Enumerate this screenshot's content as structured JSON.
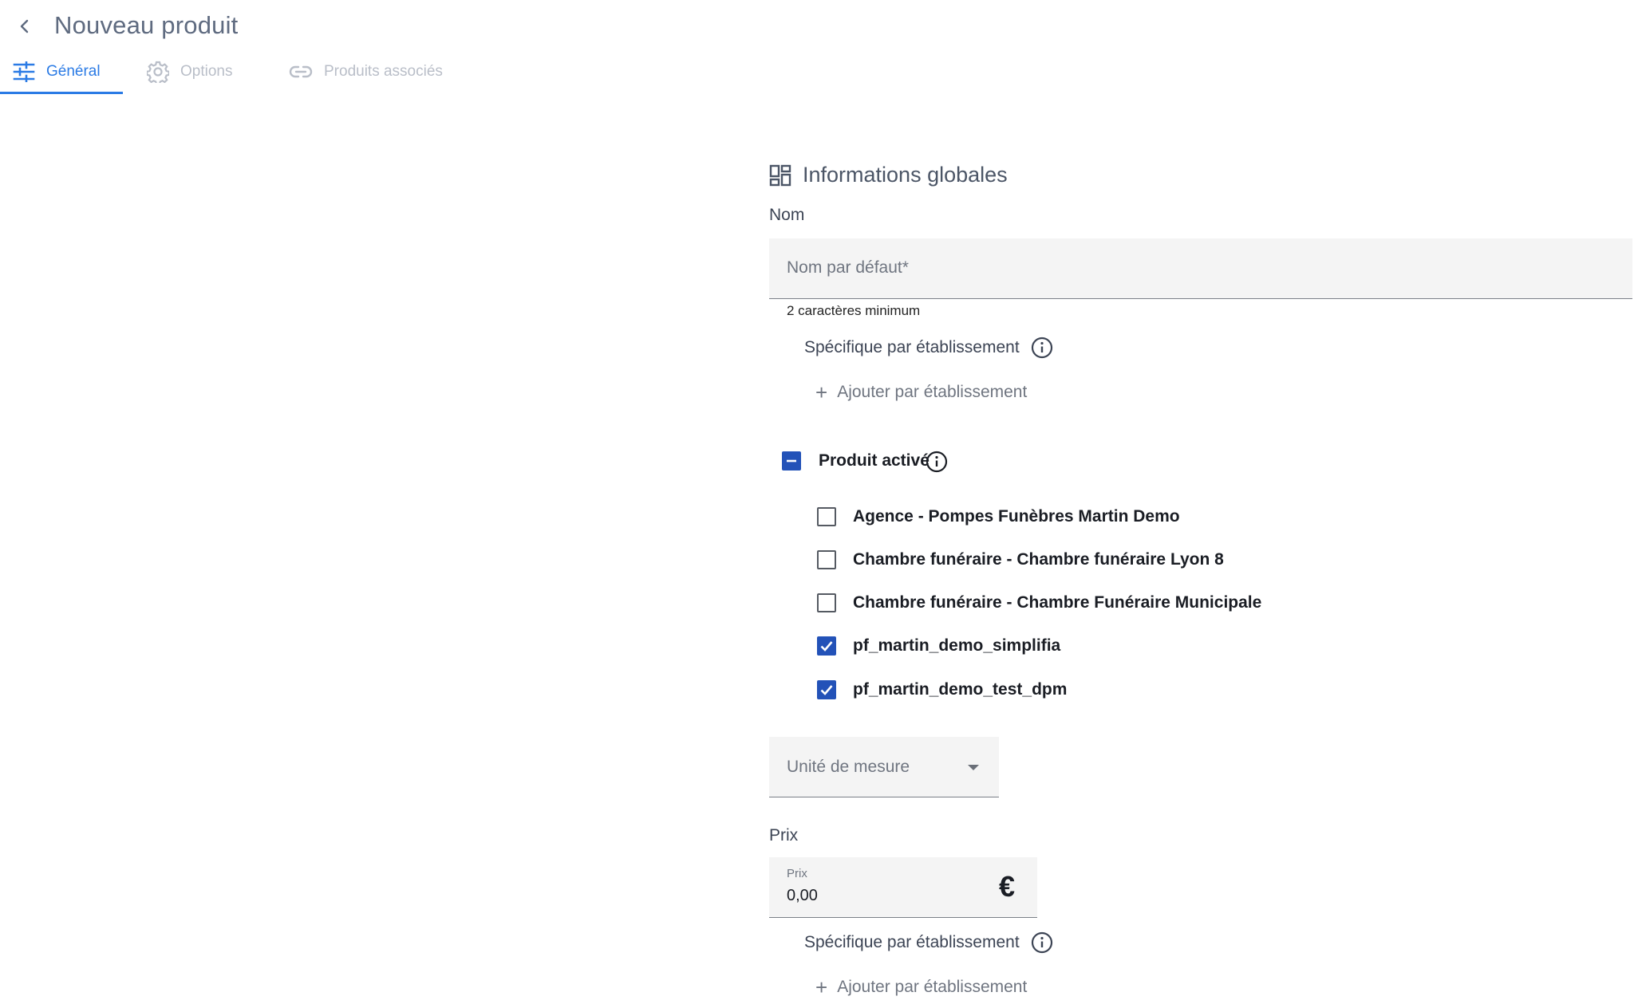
{
  "header": {
    "title": "Nouveau produit"
  },
  "tabs": [
    {
      "label": "Général",
      "active": true
    },
    {
      "label": "Options",
      "active": false
    },
    {
      "label": "Produits associés",
      "active": false
    }
  ],
  "section": {
    "title": "Informations globales"
  },
  "nom": {
    "label": "Nom",
    "placeholder": "Nom par défaut*",
    "hint": "2 caractères minimum",
    "specific_label": "Spécifique par établissement",
    "add_label": "Ajouter par établissement"
  },
  "produit_active": {
    "label": "Produit activé",
    "state": "indeterminate",
    "establishments": [
      {
        "label": "Agence - Pompes Funèbres Martin Demo",
        "checked": false
      },
      {
        "label": "Chambre funéraire - Chambre funéraire Lyon 8",
        "checked": false
      },
      {
        "label": "Chambre funéraire - Chambre Funéraire Municipale",
        "checked": false
      },
      {
        "label": "pf_martin_demo_simplifia",
        "checked": true
      },
      {
        "label": "pf_martin_demo_test_dpm",
        "checked": true
      }
    ]
  },
  "unite": {
    "placeholder": "Unité de mesure"
  },
  "prix": {
    "label": "Prix",
    "field_label": "Prix",
    "value": "0,00",
    "currency": "€",
    "specific_label": "Spécifique par établissement",
    "add_label": "Ajouter par établissement"
  },
  "colors": {
    "accent": "#2b7be5",
    "checkbox": "#2352b8",
    "tab_inactive": "#b9bec8"
  }
}
